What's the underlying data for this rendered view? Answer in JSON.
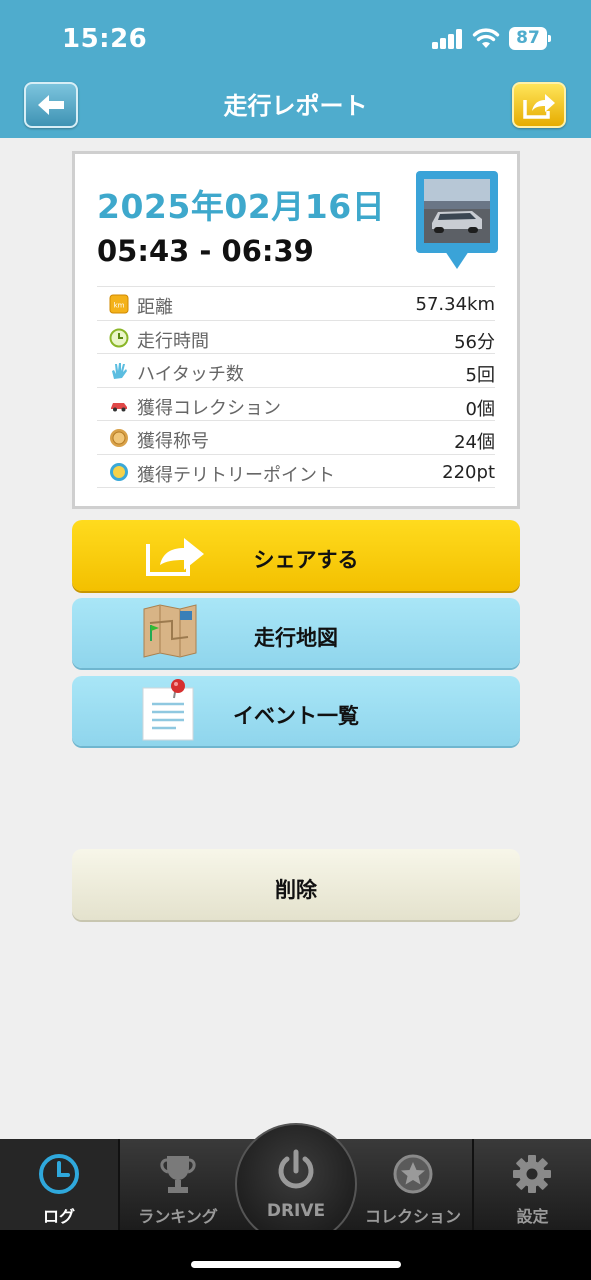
{
  "status_bar": {
    "time": "15:26",
    "battery": "87"
  },
  "nav": {
    "title": "走行レポート"
  },
  "report": {
    "date": "2025年02月16日",
    "time_range": "05:43 - 06:39",
    "stats": [
      {
        "icon": "km-icon",
        "label": "距離",
        "value": "57.34km"
      },
      {
        "icon": "clock-icon",
        "label": "走行時間",
        "value": "56分"
      },
      {
        "icon": "hand-icon",
        "label": "ハイタッチ数",
        "value": "5回"
      },
      {
        "icon": "car-icon",
        "label": "獲得コレクション",
        "value": "0個"
      },
      {
        "icon": "medal-icon",
        "label": "獲得称号",
        "value": "24個"
      },
      {
        "icon": "spot-icon",
        "label": "獲得テリトリーポイント",
        "value": "220pt"
      }
    ]
  },
  "actions": {
    "share": "シェアする",
    "map": "走行地図",
    "events": "イベント一覧",
    "delete": "削除"
  },
  "tabs": [
    {
      "label": "ログ",
      "active": true
    },
    {
      "label": "ランキング",
      "active": false
    },
    {
      "label": "DRIVE",
      "active": false
    },
    {
      "label": "コレクション",
      "active": false
    },
    {
      "label": "設定",
      "active": false
    }
  ],
  "colors": {
    "header": "#4faccd",
    "date": "#3ea8cc",
    "share": "#ffd20f",
    "secondary": "#9edcf1"
  }
}
